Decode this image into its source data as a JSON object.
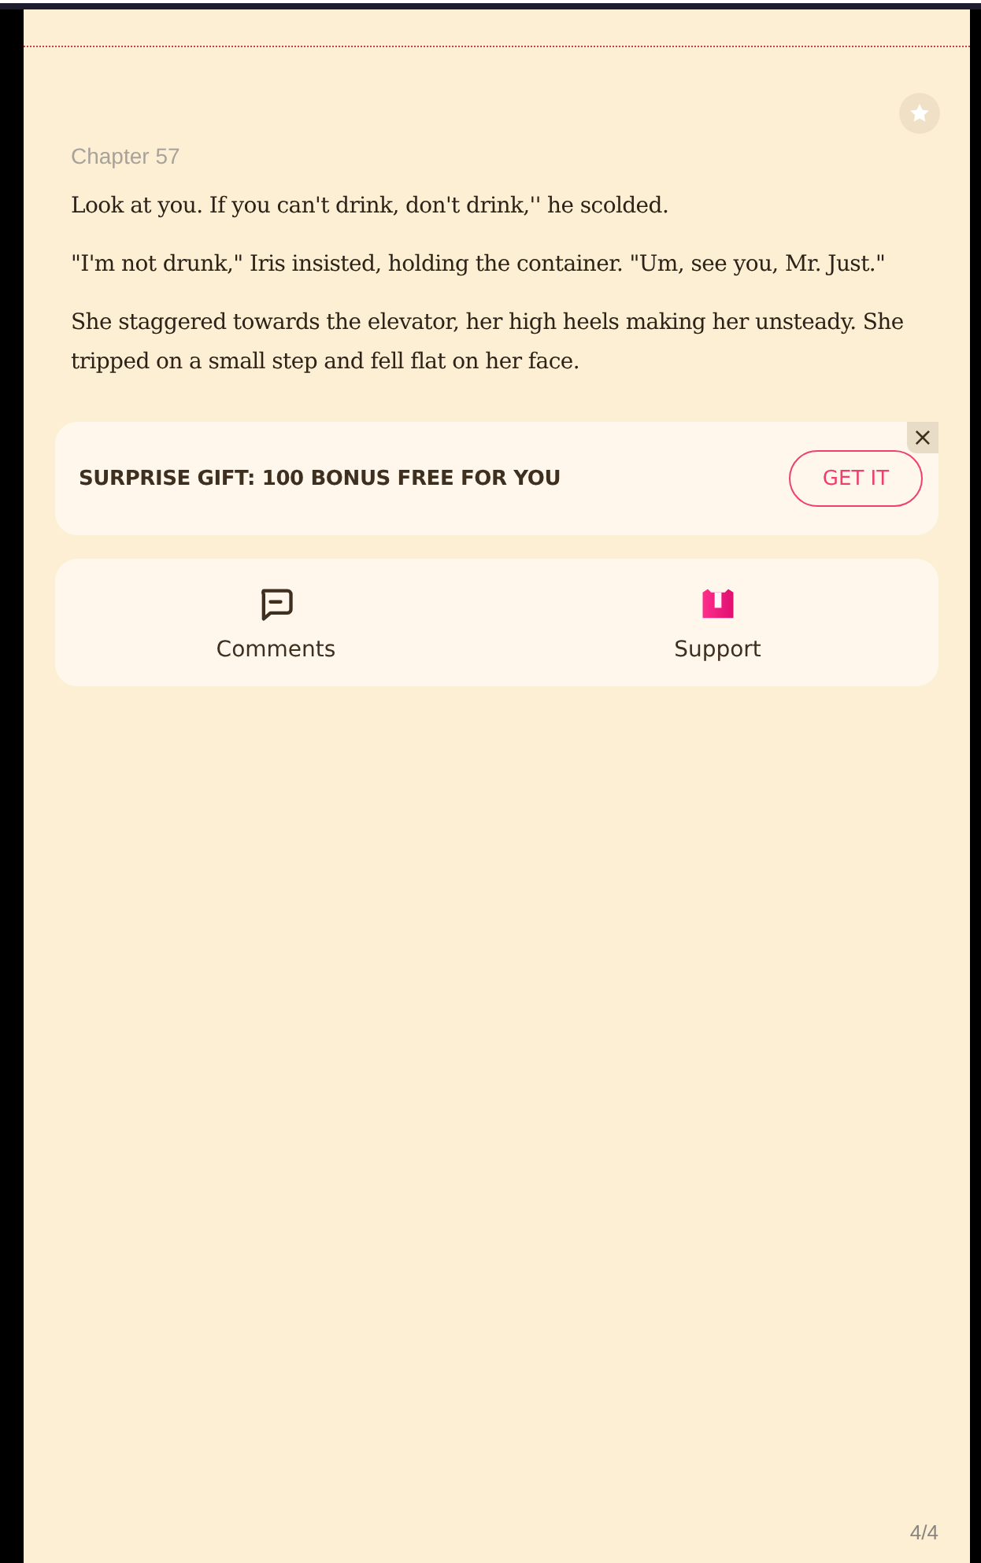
{
  "chapter": "Chapter 57",
  "paragraphs": [
    "Look at you. If you can't drink, don't drink,'' he scolded.",
    "\"I'm not drunk,\" Iris insisted, holding the container. \"Um, see you, Mr. Just.\"",
    "She staggered towards the elevator, her high heels making her unsteady. She tripped on a small step and fell flat on her face."
  ],
  "promo": {
    "text": "SURPRISE GIFT: 100 BONUS FREE FOR YOU",
    "button": "GET IT",
    "close": "×"
  },
  "actions": [
    {
      "kind": "comments",
      "label": "Comments"
    },
    {
      "kind": "support",
      "label": "Support"
    }
  ],
  "page_indicator": "4/4"
}
